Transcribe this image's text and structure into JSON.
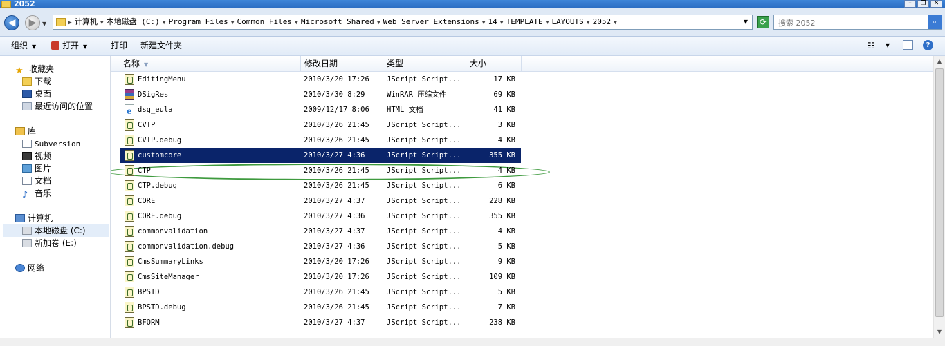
{
  "window": {
    "title": "2052"
  },
  "address": {
    "crumbs": [
      "计算机",
      "本地磁盘 (C:)",
      "Program Files",
      "Common Files",
      "Microsoft Shared",
      "Web Server Extensions",
      "14",
      "TEMPLATE",
      "LAYOUTS",
      "2052"
    ]
  },
  "search": {
    "placeholder": "搜索 2052"
  },
  "toolbar": {
    "organize": "组织",
    "open": "打开",
    "print": "打印",
    "new_folder": "新建文件夹"
  },
  "nav": {
    "favorites": "收藏夹",
    "downloads": "下载",
    "desktop": "桌面",
    "recent": "最近访问的位置",
    "libraries": "库",
    "subversion": "Subversion",
    "videos": "视频",
    "pictures": "图片",
    "documents": "文档",
    "music": "音乐",
    "computer": "计算机",
    "local_disk": "本地磁盘 (C:)",
    "new_volume": "新加卷 (E:)",
    "network": "网络"
  },
  "columns": {
    "name": "名称",
    "date": "修改日期",
    "type": "类型",
    "size": "大小"
  },
  "files": [
    {
      "name": "EditingMenu",
      "date": "2010/3/20 17:26",
      "type": "JScript Script...",
      "size": "17 KB",
      "icon": "js"
    },
    {
      "name": "DSigRes",
      "date": "2010/3/30 8:29",
      "type": "WinRAR 压缩文件",
      "size": "69 KB",
      "icon": "rar"
    },
    {
      "name": "dsg_eula",
      "date": "2009/12/17 8:06",
      "type": "HTML 文档",
      "size": "41 KB",
      "icon": "htm"
    },
    {
      "name": "CVTP",
      "date": "2010/3/26 21:45",
      "type": "JScript Script...",
      "size": "3 KB",
      "icon": "js"
    },
    {
      "name": "CVTP.debug",
      "date": "2010/3/26 21:45",
      "type": "JScript Script...",
      "size": "4 KB",
      "icon": "js"
    },
    {
      "name": "customcore",
      "date": "2010/3/27 4:36",
      "type": "JScript Script...",
      "size": "355 KB",
      "icon": "js",
      "selected": true
    },
    {
      "name": "CTP",
      "date": "2010/3/26 21:45",
      "type": "JScript Script...",
      "size": "4 KB",
      "icon": "js"
    },
    {
      "name": "CTP.debug",
      "date": "2010/3/26 21:45",
      "type": "JScript Script...",
      "size": "6 KB",
      "icon": "js"
    },
    {
      "name": "CORE",
      "date": "2010/3/27 4:37",
      "type": "JScript Script...",
      "size": "228 KB",
      "icon": "js"
    },
    {
      "name": "CORE.debug",
      "date": "2010/3/27 4:36",
      "type": "JScript Script...",
      "size": "355 KB",
      "icon": "js"
    },
    {
      "name": "commonvalidation",
      "date": "2010/3/27 4:37",
      "type": "JScript Script...",
      "size": "4 KB",
      "icon": "js"
    },
    {
      "name": "commonvalidation.debug",
      "date": "2010/3/27 4:36",
      "type": "JScript Script...",
      "size": "5 KB",
      "icon": "js"
    },
    {
      "name": "CmsSummaryLinks",
      "date": "2010/3/20 17:26",
      "type": "JScript Script...",
      "size": "9 KB",
      "icon": "js"
    },
    {
      "name": "CmsSiteManager",
      "date": "2010/3/20 17:26",
      "type": "JScript Script...",
      "size": "109 KB",
      "icon": "js"
    },
    {
      "name": "BPSTD",
      "date": "2010/3/26 21:45",
      "type": "JScript Script...",
      "size": "5 KB",
      "icon": "js"
    },
    {
      "name": "BPSTD.debug",
      "date": "2010/3/26 21:45",
      "type": "JScript Script...",
      "size": "7 KB",
      "icon": "js"
    },
    {
      "name": "BFORM",
      "date": "2010/3/27 4:37",
      "type": "JScript Script...",
      "size": "238 KB",
      "icon": "js"
    }
  ],
  "colors": {
    "selection": "#0a246a",
    "highlight_ring": "#3e9a3e"
  }
}
